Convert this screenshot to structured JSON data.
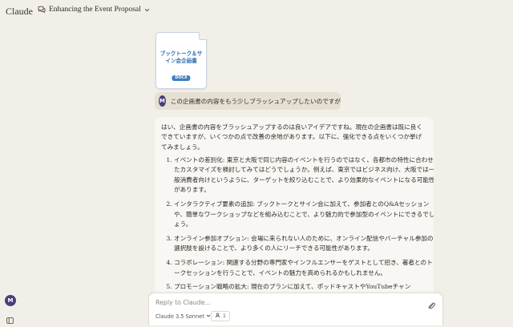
{
  "app": {
    "name": "Claude"
  },
  "conversation": {
    "title": "Enhancing the Event Proposal"
  },
  "attachment": {
    "filename": "ブックトーク＆サイン会企画書",
    "type": "DOCX"
  },
  "user": {
    "initial": "M"
  },
  "user_message": {
    "text": "この企画書の内容をもう少しブラッシュアップしたいのですが"
  },
  "assistant_message": {
    "intro": "はい、企画書の内容をブラッシュアップするのは良いアイデアですね。現在の企画書は既に良くできていますが、いくつかの点で改善の余地があります。以下に、強化できる点をいくつか挙げてみましょう。",
    "items": [
      "イベントの差別化: 東京と大阪で同じ内容のイベントを行うのではなく、各都市の特性に合わせたカスタマイズを検討してみてはどうでしょうか。例えば、東京ではビジネス向け、大阪では一般消費者向けというように、ターゲットを絞り込むことで、より効果的なイベントになる可能性があります。",
      "インタラクティブ要素の追加: ブックトークとサイン会に加えて、参加者とのQ&Aセッションや、簡単なワークショップなどを組み込むことで、より魅力的で参加型のイベントにできるでしょう。",
      "オンライン参加オプション: 会場に来られない人のために、オンライン配信やバーチャル参加の選択肢を設けることで、より多くの人にリーチできる可能性があります。",
      "コラボレーション: 関連する分野の専門家やインフルエンサーをゲストとして招き、著者とのトークセッションを行うことで、イベントの魅力を高められるかもしれません。",
      "プロモーション戦略の拡大: 現在のプランに加えて、ポッドキャストやYouTubeチャン"
    ]
  },
  "composer": {
    "placeholder": "Reply to Claude...",
    "model": "Claude 3.5 Sonnet",
    "style_count": "1"
  },
  "icons": {
    "chat": "chat-bubbles-icon",
    "chevron": "chevron-down-icon",
    "attach": "paperclip-icon",
    "sidebar": "sidebar-toggle-icon",
    "style": "people-icon"
  },
  "colors": {
    "background": "#f2efe8",
    "avatar": "#4a3f7a",
    "file_accent": "#3e7fc3"
  }
}
